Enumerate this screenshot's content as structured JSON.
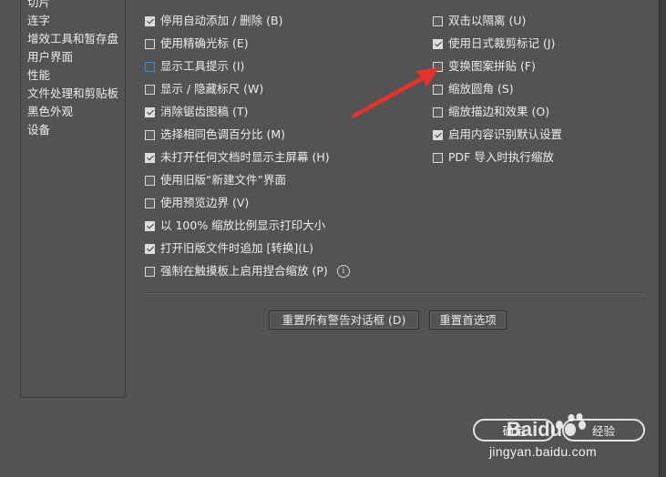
{
  "sidebar": {
    "items": [
      {
        "label": "切片"
      },
      {
        "label": "连字"
      },
      {
        "label": "增效工具和暂存盘"
      },
      {
        "label": "用户界面"
      },
      {
        "label": "性能"
      },
      {
        "label": "文件处理和剪贴板"
      },
      {
        "label": "黑色外观"
      },
      {
        "label": "设备"
      }
    ]
  },
  "options_left": [
    {
      "label": "停用自动添加 / 删除 (B)",
      "checked": true
    },
    {
      "label": "使用精确光标 (E)",
      "checked": false
    },
    {
      "label": "显示工具提示 (I)",
      "checked": false,
      "focused": true
    },
    {
      "label": "显示 / 隐藏标尺 (W)",
      "checked": false
    },
    {
      "label": "消除锯齿图稿 (T)",
      "checked": true
    },
    {
      "label": "选择相同色调百分比 (M)",
      "checked": false
    },
    {
      "label": "未打开任何文档时显示主屏幕 (H)",
      "checked": true
    },
    {
      "label": "使用旧版“新建文件”界面",
      "checked": false
    },
    {
      "label": "使用预览边界 (V)",
      "checked": false
    },
    {
      "label": "以 100% 缩放比例显示打印大小",
      "checked": true
    },
    {
      "label": "打开旧版文件时追加 [转换](L)",
      "checked": true
    },
    {
      "label": "强制在触摸板上启用捏合缩放 (P)",
      "checked": false,
      "info": "i"
    }
  ],
  "options_right": [
    {
      "label": "双击以隔离 (U)",
      "checked": false
    },
    {
      "label": "使用日式裁剪标记 (J)",
      "checked": true
    },
    {
      "label": "变换图案拼贴 (F)",
      "checked": false
    },
    {
      "label": "缩放圆角 (S)",
      "checked": false
    },
    {
      "label": "缩放描边和效果 (O)",
      "checked": false
    },
    {
      "label": "启用内容识别默认设置",
      "checked": true
    },
    {
      "label": "PDF 导入时执行缩放",
      "checked": false
    }
  ],
  "buttons": {
    "reset_warnings": "重置所有警告对话框 (D)",
    "reset_prefs": "重置首选项",
    "ok": "确定",
    "cancel": "经验"
  },
  "annotation": {
    "color": "#e8322e"
  },
  "watermark": {
    "logo_text": "Baidu",
    "url": "jingyan.baidu.com"
  }
}
